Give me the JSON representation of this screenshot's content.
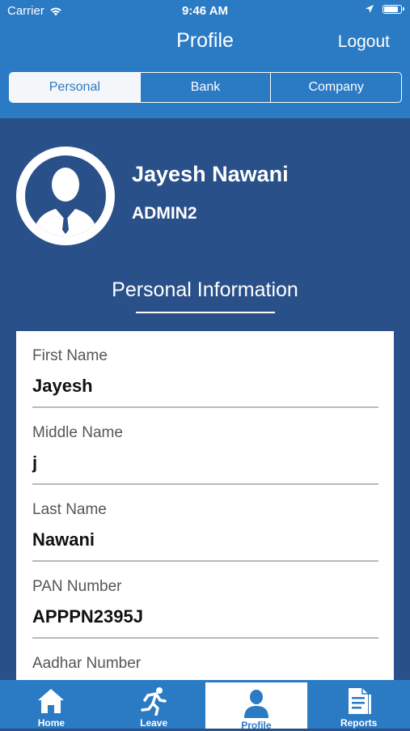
{
  "status_bar": {
    "carrier": "Carrier",
    "time": "9:46 AM",
    "battery_level": 0.85
  },
  "nav": {
    "title": "Profile",
    "logout_label": "Logout"
  },
  "segments": [
    {
      "label": "Personal",
      "active": true
    },
    {
      "label": "Bank",
      "active": false
    },
    {
      "label": "Company",
      "active": false
    }
  ],
  "profile": {
    "name": "Jayesh Nawani",
    "role": "ADMIN2"
  },
  "section": {
    "title": "Personal Information"
  },
  "fields": [
    {
      "label": "First Name",
      "value": "Jayesh"
    },
    {
      "label": "Middle Name",
      "value": "j"
    },
    {
      "label": "Last Name",
      "value": "Nawani"
    },
    {
      "label": "PAN Number",
      "value": "APPPN2395J"
    },
    {
      "label": "Aadhar Number",
      "value": ""
    }
  ],
  "tabs": [
    {
      "label": "Home",
      "icon": "home-icon",
      "active": false
    },
    {
      "label": "Leave",
      "icon": "running-person-icon",
      "active": false
    },
    {
      "label": "Profile",
      "icon": "person-icon",
      "active": true
    },
    {
      "label": "Reports",
      "icon": "document-icon",
      "active": false
    }
  ],
  "colors": {
    "bar_blue": "#2b7ac4",
    "background_navy": "#2a5089",
    "active_tab_bg": "#ffffff"
  }
}
